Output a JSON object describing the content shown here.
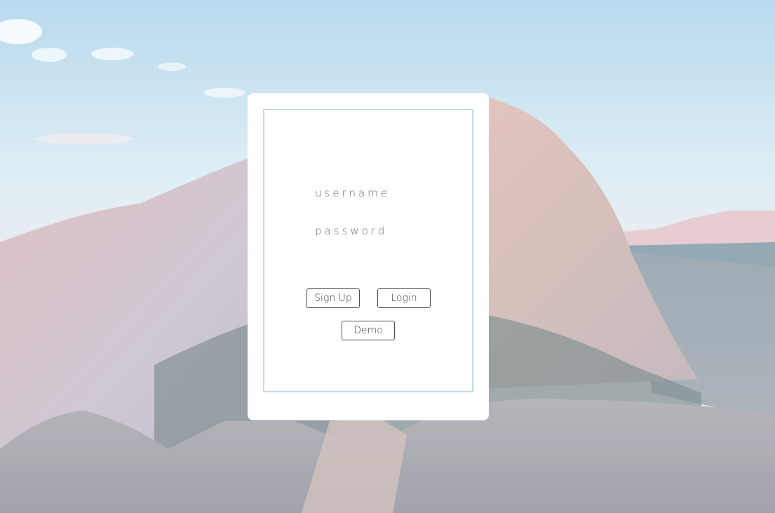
{
  "background": {
    "description_icon": "mountain-landscape-image",
    "sky_color": "#bcdcee",
    "rock_color": "#d8b7b3"
  },
  "login_form": {
    "username_placeholder": "username",
    "username_value": "",
    "password_placeholder": "password",
    "password_value": "",
    "signup_label": "Sign Up",
    "login_label": "Login",
    "demo_label": "Demo"
  },
  "colors": {
    "card_bg": "#ffffff",
    "inner_border": "#bfd9ec",
    "button_border": "#4a4a4a"
  }
}
